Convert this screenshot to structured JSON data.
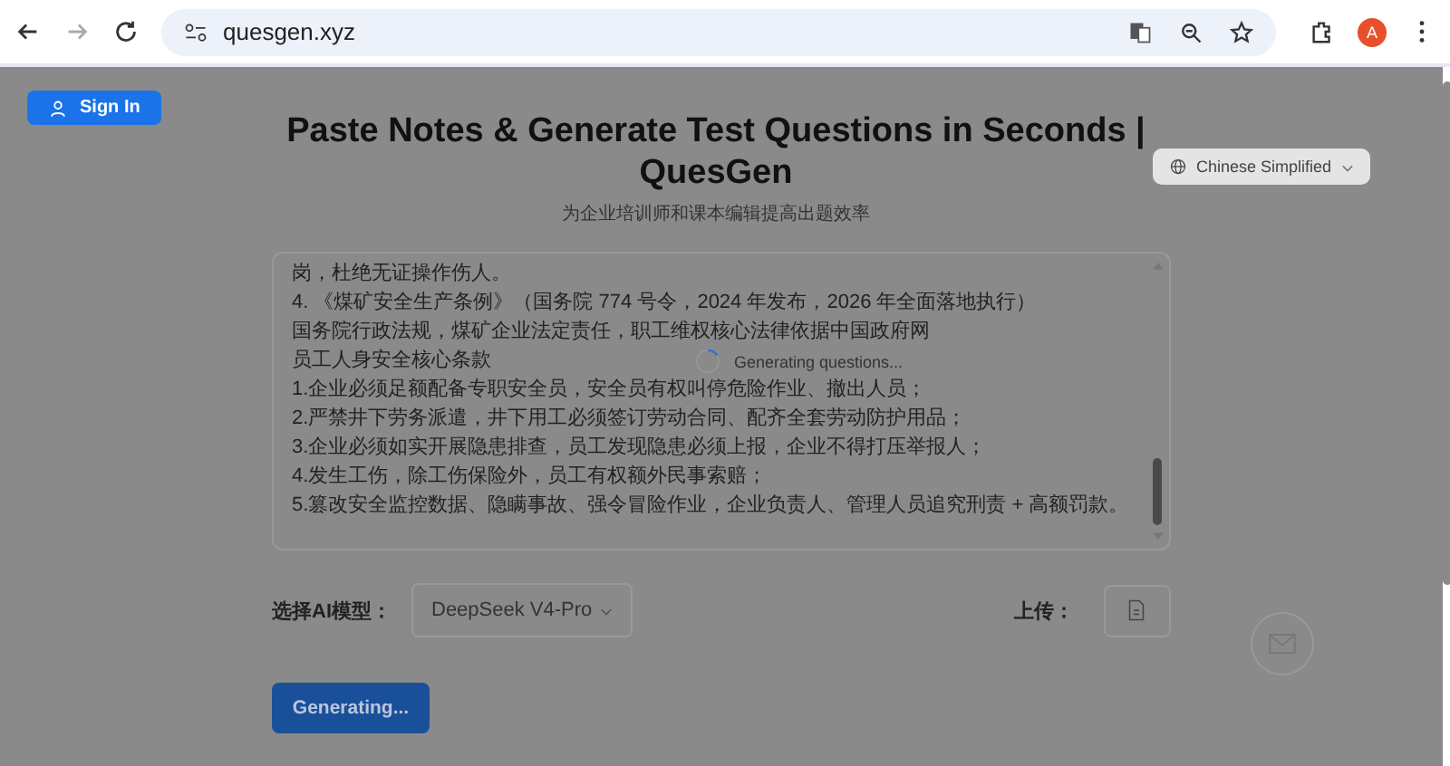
{
  "browser": {
    "url": "quesgen.xyz",
    "profile": "A"
  },
  "sign_in": {
    "label": "Sign In"
  },
  "title": "Paste Notes & Generate Test Questions in Seconds | QuesGen",
  "subtitle": "为企业培训师和课本编辑提高出题效率",
  "language": {
    "label": "Chinese Simplified"
  },
  "notes": {
    "lines": [
      "岗，杜绝无证操作伤人。",
      "4. 《煤矿安全生产条例》（国务院 774 号令，2024 年发布，2026 年全面落地执行）",
      "国务院行政法规，煤矿企业法定责任，职工维权核心法律依据中国政府网",
      "员工人身安全核心条款",
      "1.企业必须足额配备专职安全员，安全员有权叫停危险作业、撤出人员；",
      "2.严禁井下劳务派遣，井下用工必须签订劳动合同、配齐全套劳动防护用品；",
      "3.企业必须如实开展隐患排查，员工发现隐患必须上报，企业不得打压举报人；",
      "4.发生工伤，除工伤保险外，员工有权额外民事索赔；",
      "5.篡改安全监控数据、隐瞒事故、强令冒险作业，企业负责人、管理人员追究刑责 + 高额罚款。"
    ]
  },
  "loading": {
    "text": "Generating questions..."
  },
  "model": {
    "label": "选择AI模型：",
    "value": "DeepSeek V4-Pro"
  },
  "upload": {
    "label": "上传："
  },
  "generate_button": {
    "label": "Generating...",
    "disabled": true
  }
}
